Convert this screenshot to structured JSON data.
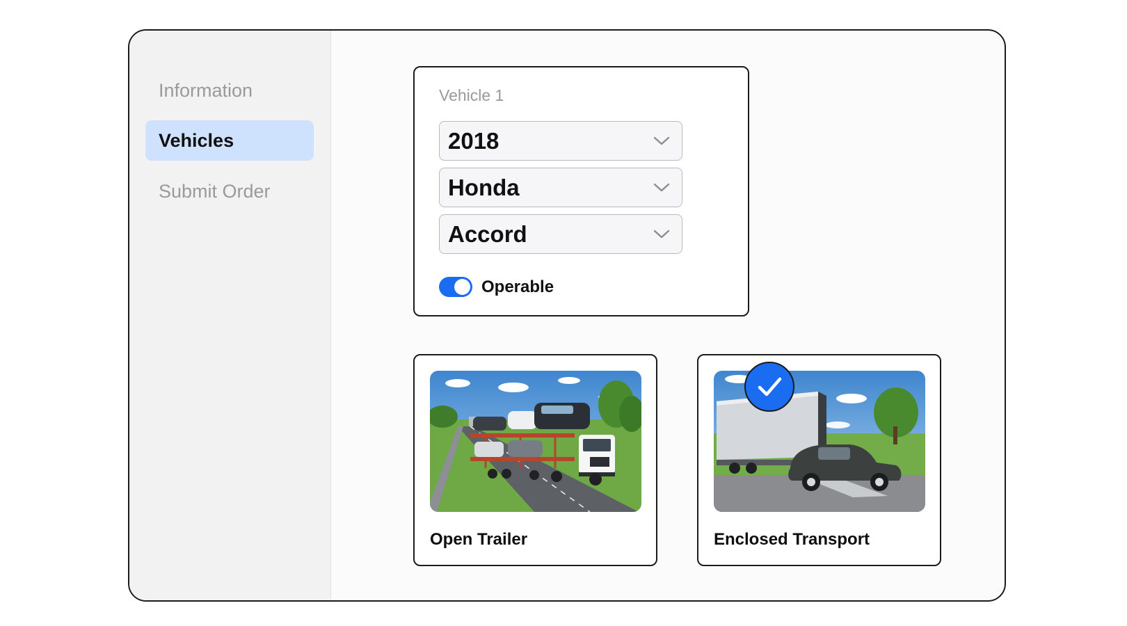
{
  "sidebar": {
    "items": [
      {
        "label": "Information",
        "active": false
      },
      {
        "label": "Vehicles",
        "active": true
      },
      {
        "label": "Submit Order",
        "active": false
      }
    ]
  },
  "vehicle_form": {
    "title": "Vehicle 1",
    "year": "2018",
    "make": "Honda",
    "model": "Accord",
    "operable_label": "Operable",
    "operable": true
  },
  "transport_options": [
    {
      "label": "Open Trailer",
      "selected": true
    },
    {
      "label": "Enclosed Transport",
      "selected": false
    }
  ],
  "colors": {
    "accent": "#1a6cf1",
    "active_nav_bg": "#cfe2fd",
    "muted_text": "#9a9a9a"
  },
  "icons": {
    "select_chevron": "chevron-down-icon",
    "selected_badge": "check-icon"
  }
}
